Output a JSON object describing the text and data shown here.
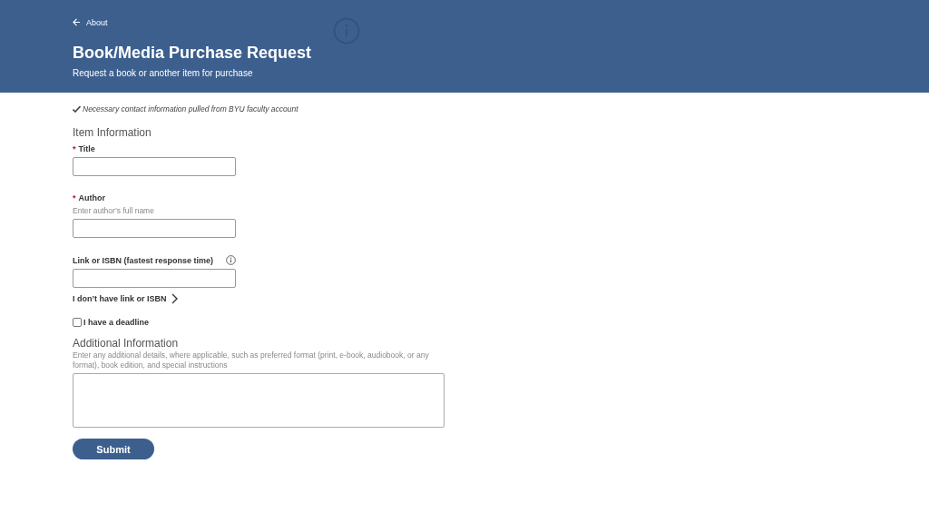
{
  "header": {
    "back_link": "About",
    "title": "Book/Media Purchase Request",
    "subtitle": "Request a book or another item for purchase"
  },
  "notice": "Necessary contact information pulled from BYU faculty account",
  "section_title": "Item Information",
  "required_mark": "*",
  "fields": [
    {
      "label": "Title",
      "required": true,
      "info": false
    },
    {
      "label": "Author",
      "required": true,
      "hint": "Enter author’s full name",
      "info": false
    },
    {
      "label": "Link or ISBN (fastest response time)",
      "required": false,
      "info": true
    }
  ],
  "toggle_link": "I don’t have link or ISBN",
  "deadline": {
    "label": "I have a deadline",
    "checked": false
  },
  "additional": {
    "title": "Additional Information",
    "hint": "Enter any additional details, where applicable, such as preferred format (print, e-book, audiobook, or any format), book edition, and special instructions"
  },
  "submit": "Submit"
}
